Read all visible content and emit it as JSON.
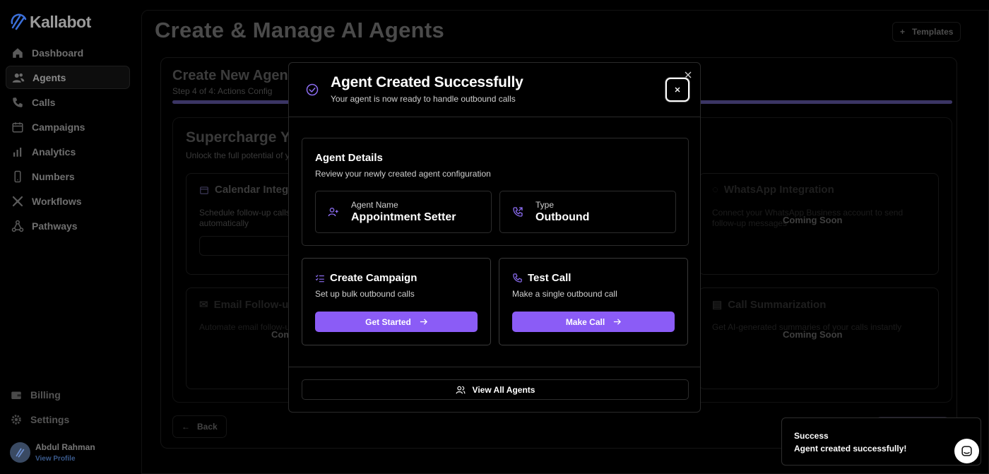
{
  "brand": {
    "name": "Kallabot"
  },
  "sidebar": {
    "items": [
      {
        "label": "Dashboard",
        "icon": "home-icon"
      },
      {
        "label": "Agents",
        "icon": "users-icon"
      },
      {
        "label": "Calls",
        "icon": "phone-icon"
      },
      {
        "label": "Campaigns",
        "icon": "calendar-icon"
      },
      {
        "label": "Analytics",
        "icon": "bar-chart-icon"
      },
      {
        "label": "Numbers",
        "icon": "smartphone-icon"
      },
      {
        "label": "Workflows",
        "icon": "workflow-icon"
      },
      {
        "label": "Pathways",
        "icon": "pathway-icon"
      }
    ],
    "bottom": [
      {
        "label": "Billing",
        "icon": "wallet-icon"
      },
      {
        "label": "Settings",
        "icon": "gear-icon"
      }
    ],
    "user": {
      "name": "Abdul Rahman",
      "link": "View Profile"
    }
  },
  "header": {
    "title": "Create & Manage AI Agents",
    "templates_label": "Templates"
  },
  "wizard": {
    "title": "Create New Agent",
    "step": "Step 4 of 4: Actions Config",
    "progress": 1.0,
    "section_title": "Supercharge Your Agent",
    "section_sub": "Unlock the full potential of your AI agent with these powerful integrations to enhance your agent's capabilities.",
    "integrations": [
      {
        "title": "Calendar Integration",
        "desc": "Schedule follow-up calls automatically"
      },
      {
        "title": "WhatsApp Integration",
        "desc": "Connect your WhatsApp Business account to send follow-up messages",
        "status": "Coming Soon"
      },
      {
        "title": "Email Follow-up",
        "desc": "Automate email follow-ups after calls",
        "status": "Coming Soon"
      },
      {
        "title": "Call Summarization",
        "desc": "Get AI-generated summaries of your calls instantly",
        "status": "Coming Soon"
      }
    ],
    "back_label": "Back"
  },
  "modal": {
    "title": "Agent Created Successfully",
    "subtitle": "Your agent is now ready to handle outbound calls",
    "details": {
      "title": "Agent Details",
      "subtitle": "Review your newly created agent configuration",
      "name_label": "Agent Name",
      "name_value": "Appointment Setter",
      "type_label": "Type",
      "type_value": "Outbound"
    },
    "campaign": {
      "title": "Create Campaign",
      "subtitle": "Set up bulk outbound calls",
      "button": "Get Started"
    },
    "test_call": {
      "title": "Test Call",
      "subtitle": "Make a single outbound call",
      "button": "Make Call"
    },
    "view_all": "View All Agents"
  },
  "toast": {
    "title": "Success",
    "message": "Agent created successfully!"
  },
  "colors": {
    "accent": "#8b5cf6",
    "background": "#000000"
  }
}
